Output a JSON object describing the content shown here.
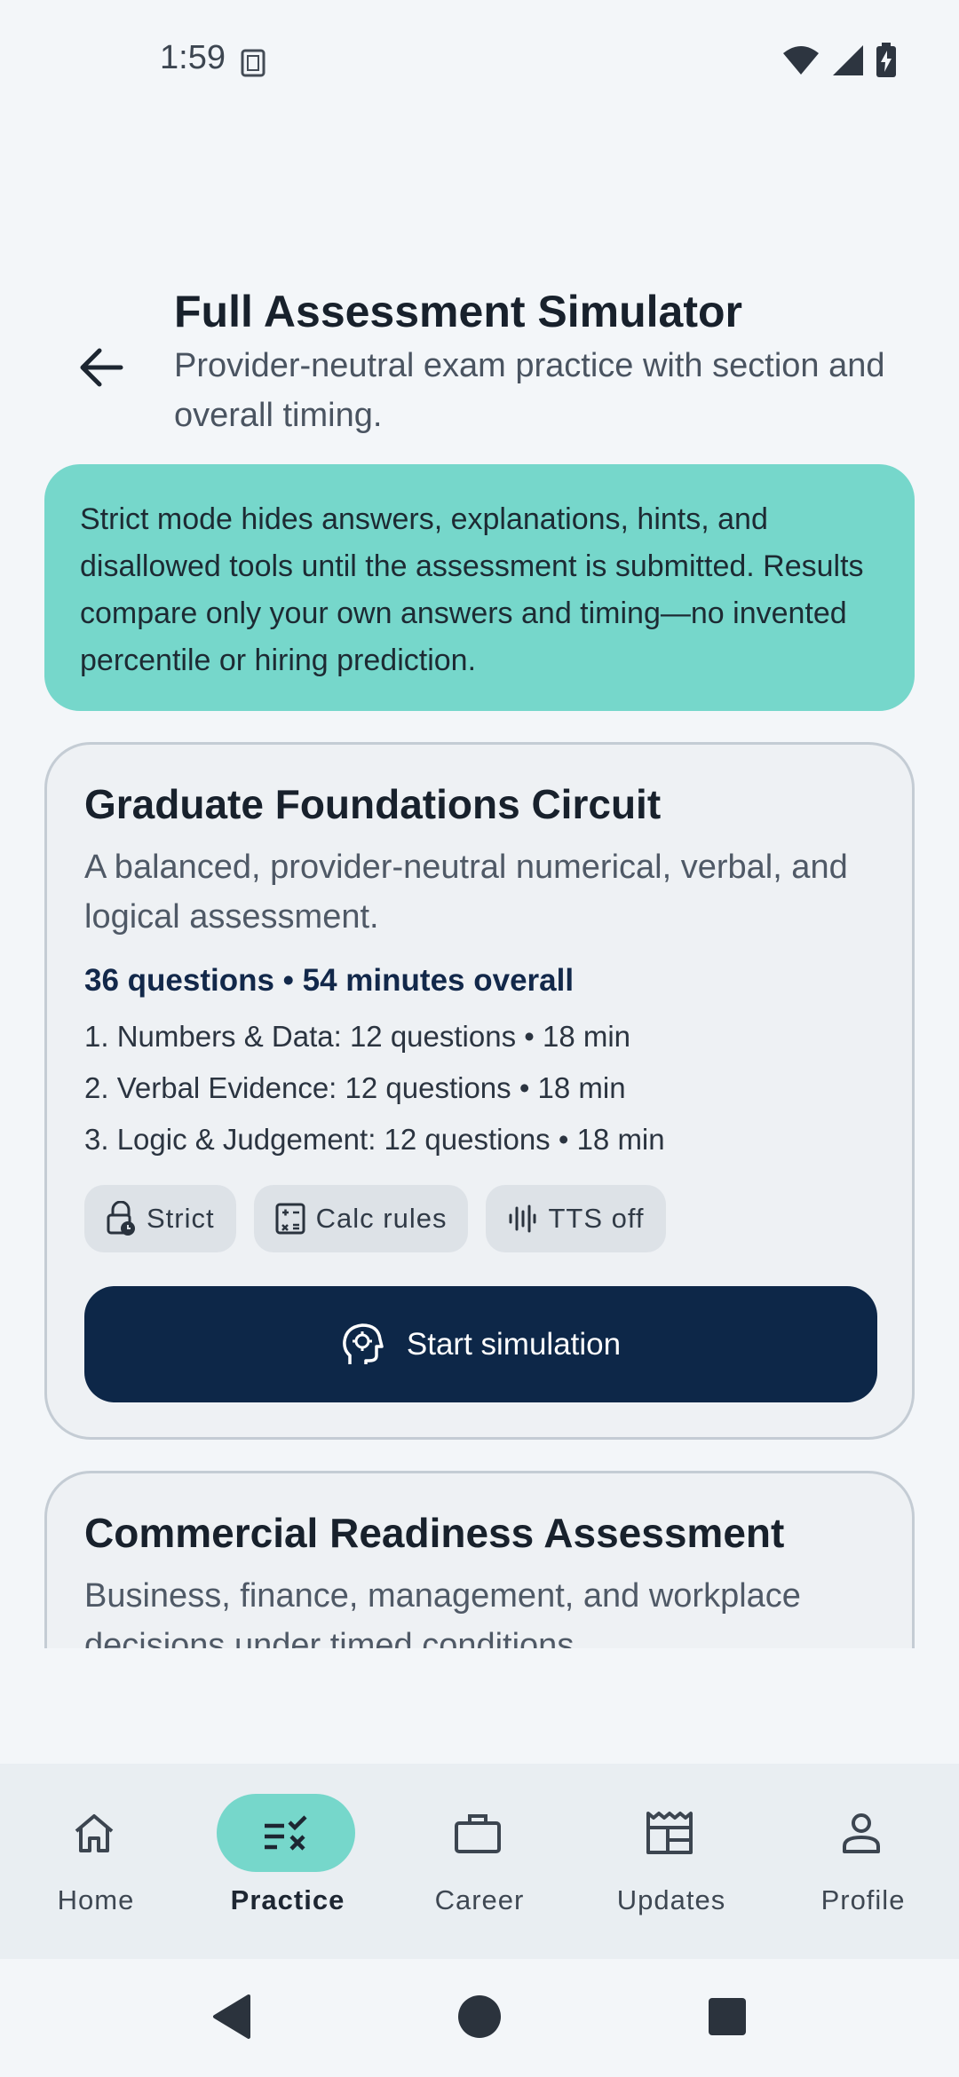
{
  "status_bar": {
    "time": "1:59",
    "icons": [
      "sim-card-icon",
      "wifi-icon",
      "cellular-signal-icon",
      "battery-charging-icon"
    ]
  },
  "header": {
    "back_icon": "arrow-left-icon",
    "title": "Full Assessment Simulator",
    "subtitle": "Provider-neutral exam practice with section and overall timing."
  },
  "notice": {
    "text": "Strict mode hides answers, explanations, hints, and disallowed tools until the assessment is submitted. Results compare only your own answers and timing—no invented percentile or hiring prediction."
  },
  "assessments": [
    {
      "title": "Graduate Foundations Circuit",
      "description": "A balanced, provider-neutral numerical, verbal, and logical assessment.",
      "summary": "36 questions • 54 minutes overall",
      "sections": [
        "1. Numbers & Data: 12 questions • 18 min",
        "2. Verbal Evidence: 12 questions • 18 min",
        "3. Logic & Judgement: 12 questions • 18 min"
      ],
      "chips": [
        {
          "label": "Strict",
          "icon": "lock-clock-icon"
        },
        {
          "label": "Calc rules",
          "icon": "calculator-icon"
        },
        {
          "label": "TTS off",
          "icon": "audio-wave-icon"
        }
      ],
      "start_label": "Start simulation",
      "start_icon": "brain-gear-icon"
    },
    {
      "title": "Commercial Readiness Assessment",
      "description": "Business, finance, management, and workplace decisions under timed conditions."
    }
  ],
  "bottom_nav": {
    "items": [
      {
        "label": "Home",
        "icon": "home-icon",
        "active": false
      },
      {
        "label": "Practice",
        "icon": "practice-icon",
        "active": true
      },
      {
        "label": "Career",
        "icon": "briefcase-icon",
        "active": false
      },
      {
        "label": "Updates",
        "icon": "newspaper-icon",
        "active": false
      },
      {
        "label": "Profile",
        "icon": "person-icon",
        "active": false
      }
    ]
  },
  "system_nav": [
    "back-triangle-icon",
    "home-circle-icon",
    "recents-square-icon"
  ],
  "colors": {
    "background": "#f3f6f9",
    "accent": "#76d7cb",
    "primary_button": "#0d2748",
    "summary_text": "#12284a"
  }
}
